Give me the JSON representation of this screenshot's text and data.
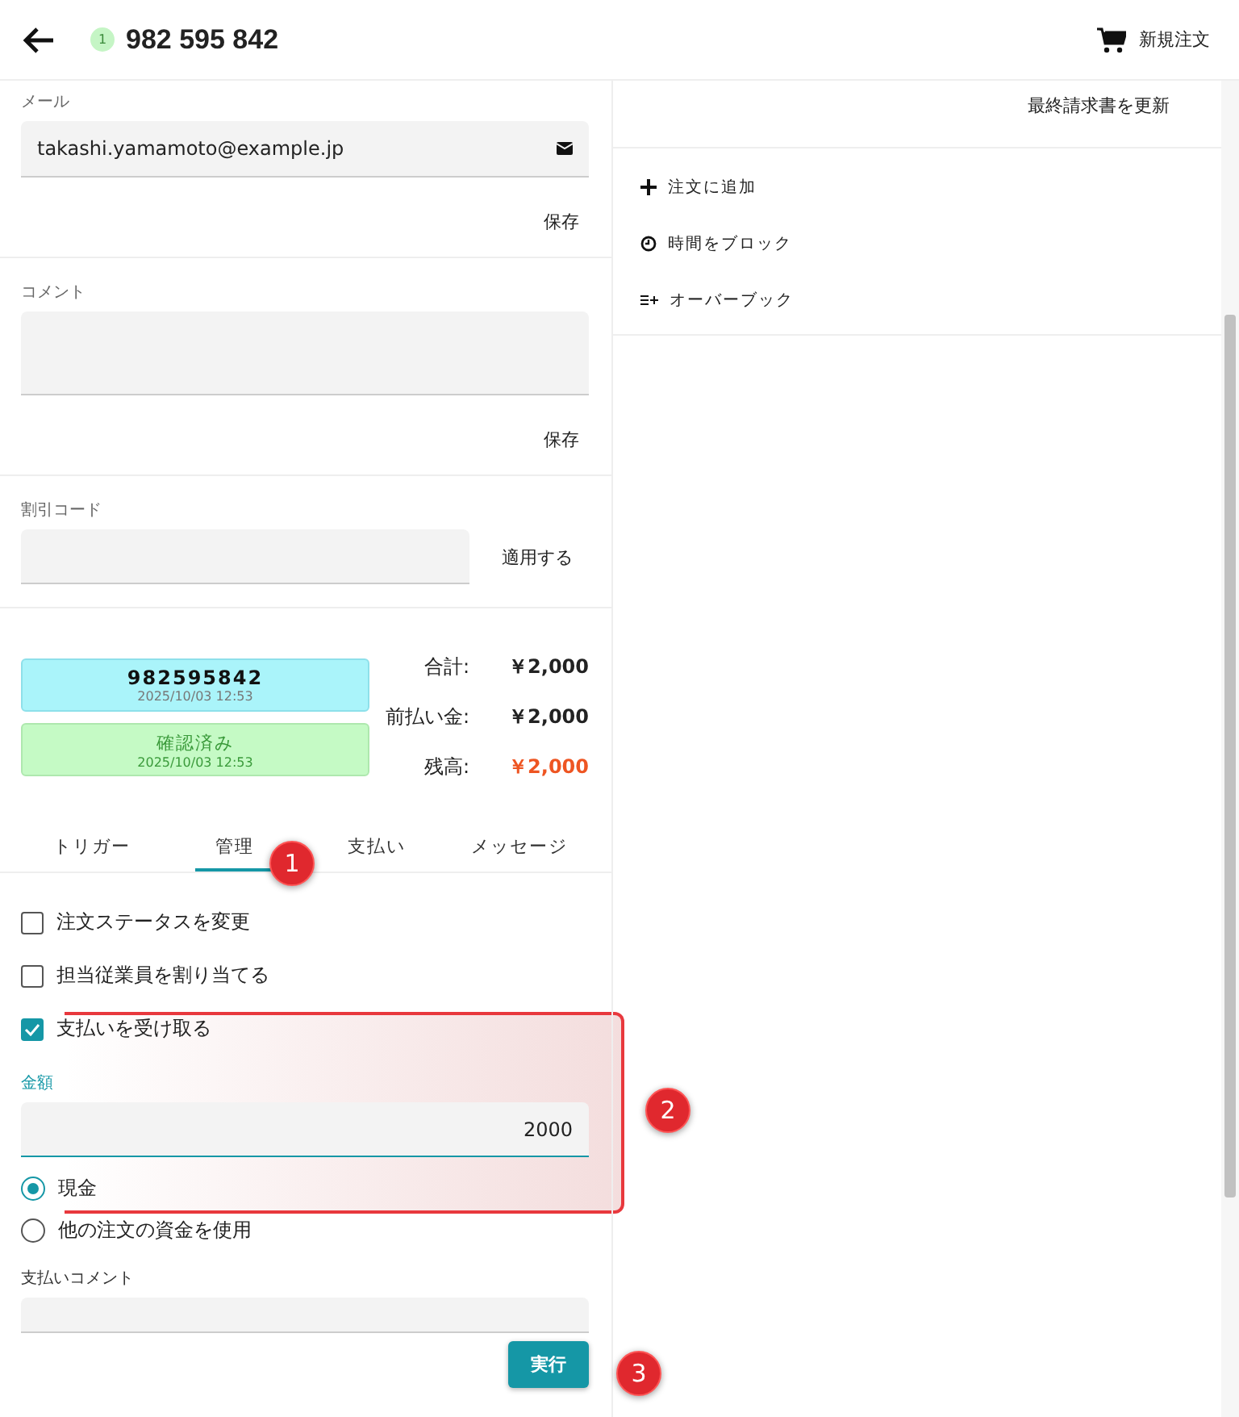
{
  "header": {
    "badge": "1",
    "title": "982 595 842",
    "new_order": "新規注文"
  },
  "email": {
    "label": "メール",
    "value": "takashi.yamamoto@example.jp",
    "save": "保存"
  },
  "comment": {
    "label": "コメント",
    "save": "保存"
  },
  "discount": {
    "label": "割引コード",
    "apply": "適用する"
  },
  "status_cards": [
    {
      "title": "982595842",
      "time": "2025/10/03 12:53",
      "color": "#aaf4fa"
    },
    {
      "title": "確認済み",
      "time": "2025/10/03 12:53",
      "color": "#c5fac5"
    }
  ],
  "totals": [
    {
      "label": "合計:",
      "value": "￥2,000",
      "kind": "normal"
    },
    {
      "label": "前払い金:",
      "value": "￥2,000",
      "kind": "normal"
    },
    {
      "label": "残高:",
      "value": "￥2,000",
      "kind": "due"
    }
  ],
  "tabs": [
    {
      "label": "トリガー",
      "selected": false
    },
    {
      "label": "管理",
      "selected": true
    },
    {
      "label": "支払い",
      "selected": false
    },
    {
      "label": "メッセージ",
      "selected": false
    }
  ],
  "options": [
    {
      "label": "注文ステータスを変更",
      "checked": false
    },
    {
      "label": "担当従業員を割り当てる",
      "checked": false
    },
    {
      "label": "支払いを受け取る",
      "checked": true
    }
  ],
  "amount": {
    "label": "金額",
    "value": "2000"
  },
  "payment_methods": [
    {
      "label": "現金",
      "selected": true
    },
    {
      "label": "他の注文の資金を使用",
      "selected": false
    }
  ],
  "payment_comment": {
    "label": "支払いコメント"
  },
  "execute": "実行",
  "right_panel": {
    "update_invoice": "最終請求書を更新",
    "actions": [
      {
        "label": "注文に追加",
        "kind": "plus"
      },
      {
        "label": "時間をブロック",
        "kind": "clock"
      },
      {
        "label": "オーバーブック",
        "kind": "overbook"
      }
    ]
  },
  "callouts": [
    "1",
    "2",
    "3"
  ]
}
